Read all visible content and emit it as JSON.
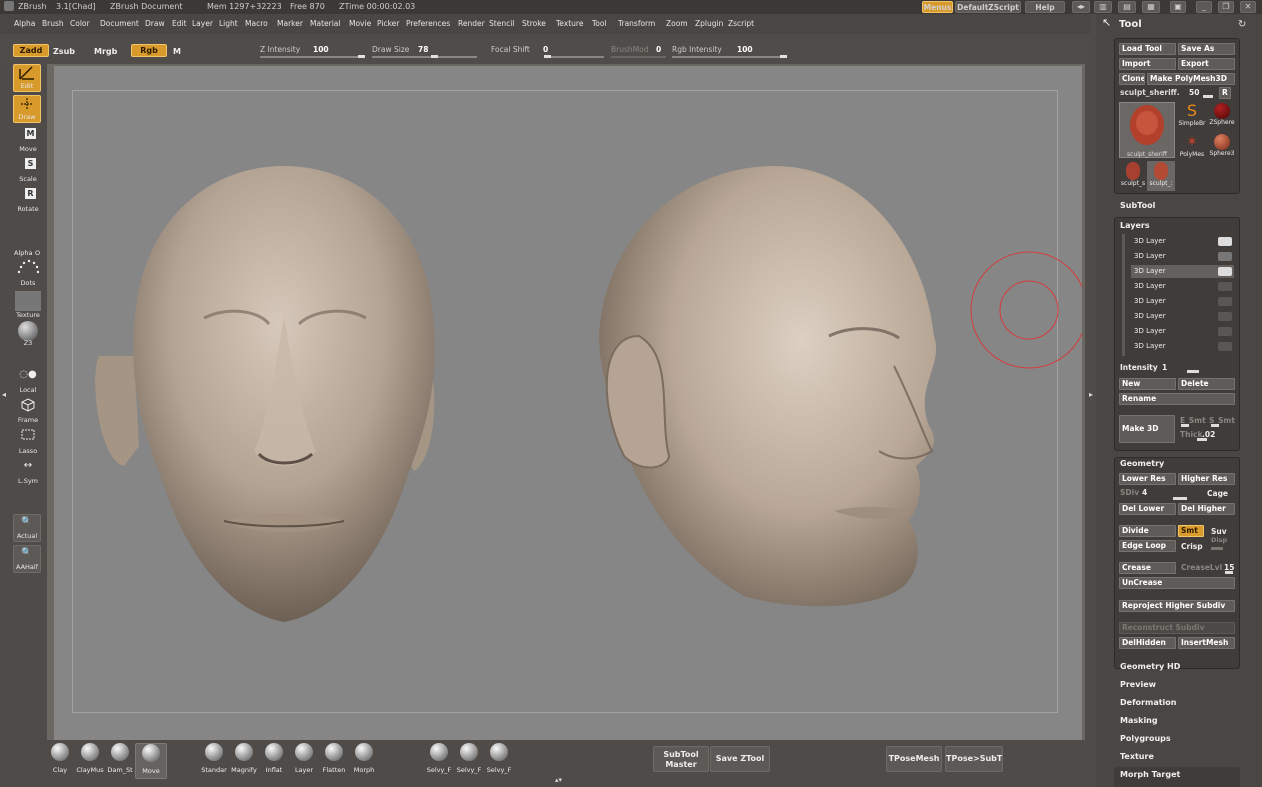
{
  "titlebar": {
    "app": "ZBrush",
    "version": "3.1[Chad]",
    "document": "ZBrush Document",
    "mem": "Mem 1297+32223",
    "free": "Free 870",
    "ztime": "ZTime 00:00:02.03",
    "menus_btn": "Menus",
    "zscript_btn": "DefaultZScript",
    "help_btn": "Help"
  },
  "menu": [
    "Alpha",
    "Brush",
    "Color",
    "Document",
    "Draw",
    "Edit",
    "Layer",
    "Light",
    "Macro",
    "Marker",
    "Material",
    "Movie",
    "Picker",
    "Preferences",
    "Render",
    "Stencil",
    "Stroke",
    "Texture",
    "Tool",
    "Transform",
    "Zoom",
    "Zplugin",
    "Zscript"
  ],
  "options": {
    "zadd": "Zadd",
    "zsub": "Zsub",
    "mrgb": "Mrgb",
    "rgb": "Rgb",
    "m": "M",
    "zint_label": "Z Intensity",
    "zint_value": "100",
    "draw_size_label": "Draw Size",
    "draw_size_value": "78",
    "focal_label": "Focal Shift",
    "focal_value": "0",
    "brushmod_label": "BrushMod",
    "brushmod_value": "0",
    "rgbint_label": "Rgb Intensity",
    "rgbint_value": "100",
    "zint_level": 1.0,
    "draw_size_level": 0.6,
    "focal_level": 0.0,
    "rgbint_level": 1.0
  },
  "left_tools": [
    "Edit",
    "Draw",
    "Move",
    "Scale",
    "Rotate",
    "Alpha",
    "Dots",
    "Texture",
    "Local",
    "Frame",
    "Lasso",
    "L.Sym",
    "Actual",
    "AAHalf"
  ],
  "alpha_o": "O",
  "bottom": {
    "brushes": [
      "Clay",
      "ClayMus",
      "Dam_St",
      "Move",
      "Standar",
      "Magnify",
      "Inflat",
      "Layer",
      "Flatten",
      "Morph",
      "Selvy_F",
      "Selvy_F",
      "Selvy_F"
    ],
    "subtool_master_1": "SubTool",
    "subtool_master_2": "Master",
    "save_ztool": "Save ZTool",
    "tposemesh": "TPoseMesh",
    "tpose_subt": "TPose>SubT"
  },
  "panel": {
    "title": "Tool",
    "load_tool": "Load Tool",
    "save_as": "Save As",
    "import": "Import",
    "export": "Export",
    "clone": "Clone",
    "make_polymesh": "Make PolyMesh3D",
    "tool_name": "sculpt_sheriff.",
    "tool_count": "50",
    "r_btn": "R",
    "thumb_main": "sculpt_sheriff",
    "thumbs": [
      "SimpleBr",
      "ZSphere",
      "PolyMes",
      "Sphere3"
    ],
    "small_thumbs": [
      "sculpt_s",
      "sculpt_:"
    ],
    "subtool": "SubTool",
    "layers": "Layers",
    "layer_rows": [
      "3D Layer",
      "3D Layer",
      "3D Layer",
      "3D Layer",
      "3D Layer",
      "3D Layer",
      "3D Layer",
      "3D Layer"
    ],
    "intensity_label": "Intensity",
    "intensity_value": "1",
    "new": "New",
    "delete": "Delete",
    "rename": "Rename",
    "make3d": "Make 3D",
    "esmt": "E_Smt",
    "ssmt": "S_Smt",
    "thick_label": "Thick",
    "thick_value": ".02",
    "geometry": "Geometry",
    "lower_res": "Lower Res",
    "higher_res": "Higher Res",
    "sdiv_label": "SDiv",
    "sdiv_value": "4",
    "cage": "Cage",
    "del_lower": "Del Lower",
    "del_higher": "Del Higher",
    "divide": "Divide",
    "smt": "Smt",
    "suv": "Suv",
    "edge_loop": "Edge Loop",
    "crisp": "Crisp",
    "disp": "Disp",
    "crease": "Crease",
    "creaselvl_label": "CreaseLvl",
    "creaselvl_value": "15",
    "uncrease": "UnCrease",
    "reproject": "Reproject Higher Subdiv",
    "reconstruct": "Reconstruct Subdiv",
    "delhidden": "DelHidden",
    "insertmesh": "InsertMesh",
    "sections": [
      "Geometry HD",
      "Preview",
      "Deformation",
      "Masking",
      "Polygroups",
      "Texture",
      "Morph Target"
    ]
  },
  "colors": {
    "accent": "#d89a2a",
    "bg": "#4f4b48",
    "canvas": "#868686",
    "head": "#b8a899",
    "brush_ring": "#d43c3c"
  }
}
